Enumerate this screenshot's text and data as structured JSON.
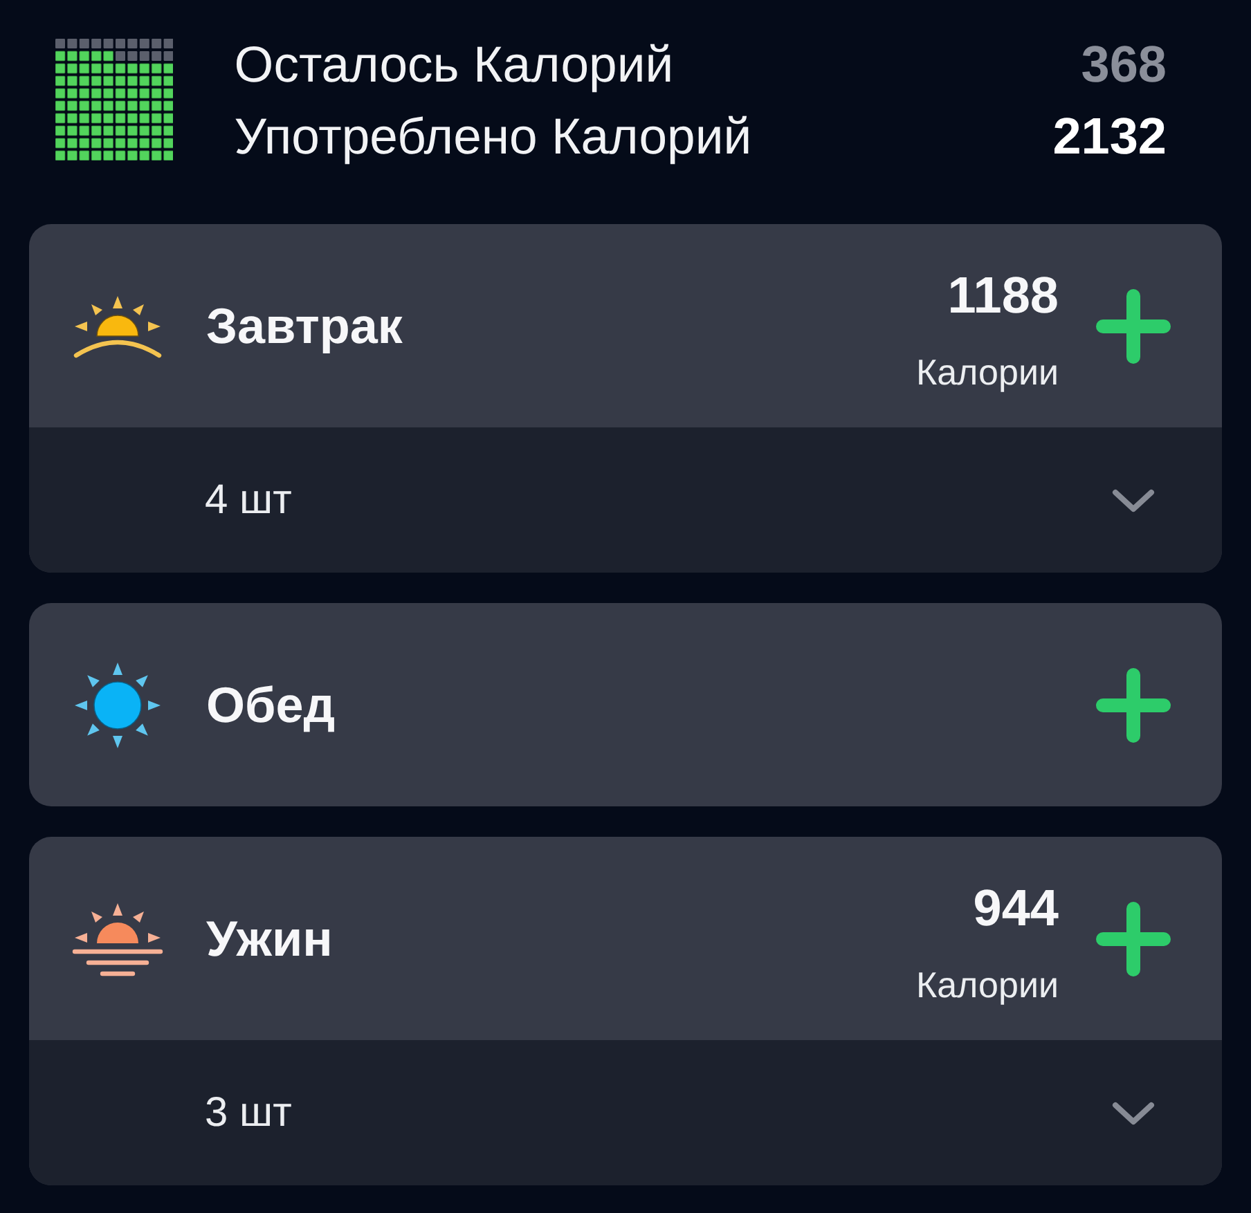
{
  "summary": {
    "level": 0.85,
    "rows": [
      {
        "kind": "remaining",
        "label": "Осталось Калорий",
        "value": "368"
      },
      {
        "kind": "consumed",
        "label": "Употреблено Калорий",
        "value": "2132"
      }
    ]
  },
  "meals": [
    {
      "kind": "breakfast",
      "name": "Завтрак",
      "calories": "1188",
      "calories_label": "Калории",
      "count": "4 шт",
      "expanded": false
    },
    {
      "kind": "lunch",
      "name": "Обед"
    },
    {
      "kind": "dinner",
      "name": "Ужин",
      "calories": "944",
      "calories_label": "Калории",
      "count": "3 шт",
      "expanded": false
    }
  ]
}
